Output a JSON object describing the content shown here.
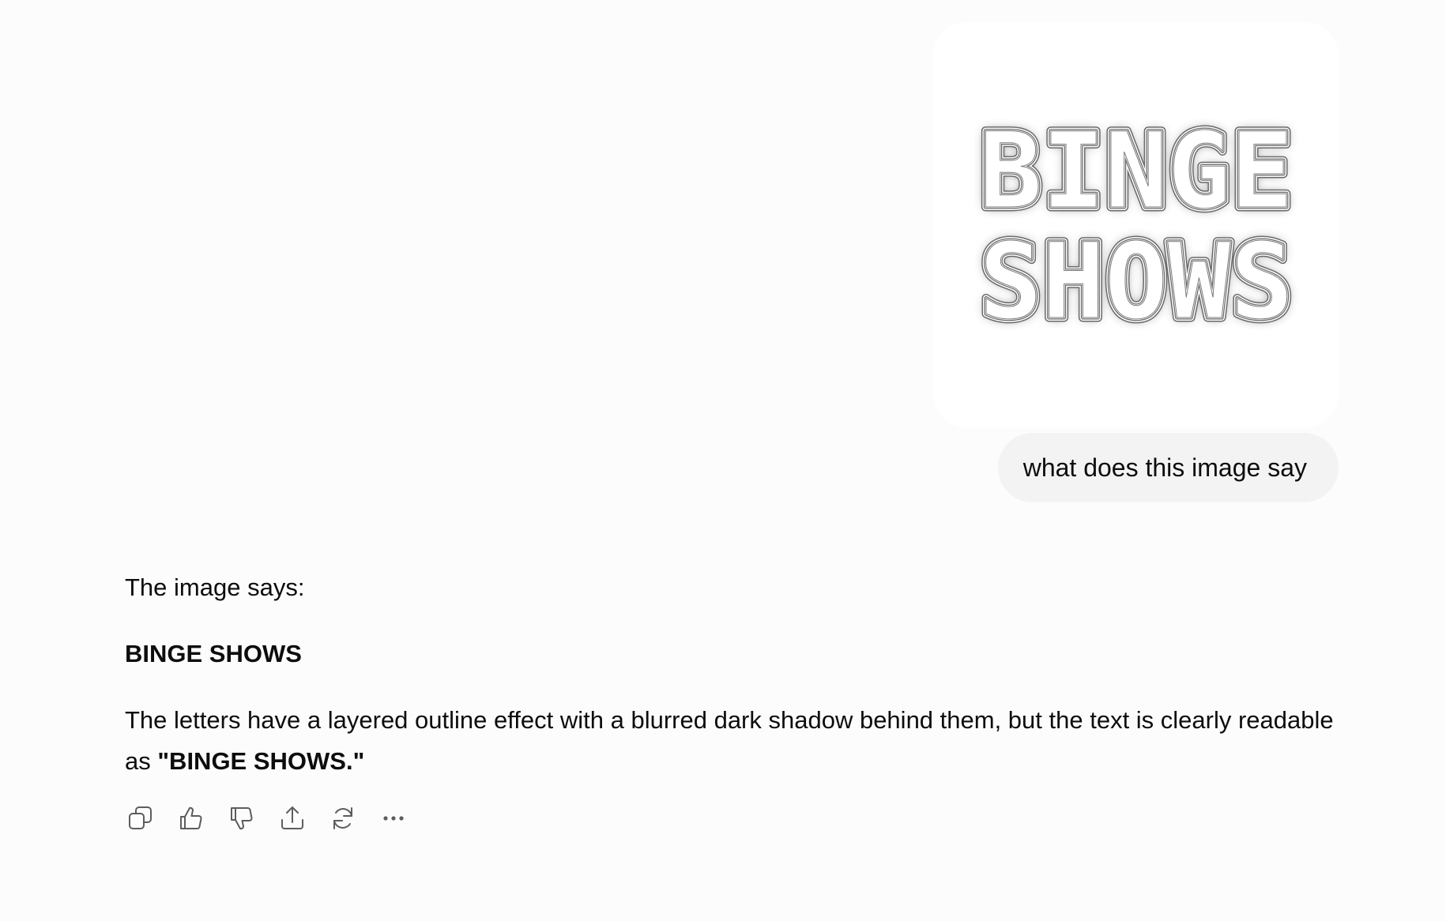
{
  "conversation": {
    "user_image": {
      "alt_text_line1": "BINGE",
      "alt_text_line2": "SHOWS"
    },
    "user_message": "what does this image say",
    "assistant": {
      "intro": "The image says:",
      "heading": "BINGE SHOWS",
      "body_prefix": "The letters have a layered outline effect with a blurred dark shadow behind them, but the text is clearly readable as ",
      "body_emphasis": "\"BINGE SHOWS.\""
    }
  },
  "actions": [
    {
      "name": "copy",
      "icon": "copy-icon"
    },
    {
      "name": "thumbs-up",
      "icon": "thumbs-up-icon"
    },
    {
      "name": "thumbs-down",
      "icon": "thumbs-down-icon"
    },
    {
      "name": "share",
      "icon": "share-icon"
    },
    {
      "name": "regenerate",
      "icon": "refresh-icon"
    },
    {
      "name": "more",
      "icon": "more-dots-icon"
    }
  ],
  "colors": {
    "background": "#fcfcfc",
    "bubble": "#f3f3f3",
    "text": "#0d0d0d",
    "icon": "#5d5d5d"
  }
}
